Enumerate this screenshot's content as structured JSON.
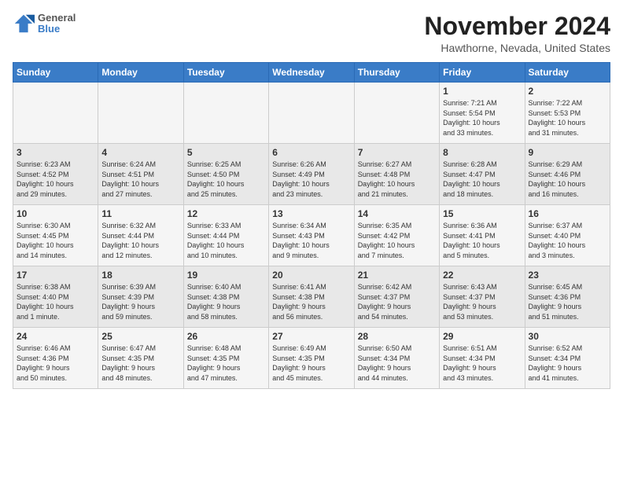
{
  "logo": {
    "line1": "General",
    "line2": "Blue"
  },
  "title": "November 2024",
  "location": "Hawthorne, Nevada, United States",
  "days_of_week": [
    "Sunday",
    "Monday",
    "Tuesday",
    "Wednesday",
    "Thursday",
    "Friday",
    "Saturday"
  ],
  "weeks": [
    [
      {
        "day": "",
        "info": ""
      },
      {
        "day": "",
        "info": ""
      },
      {
        "day": "",
        "info": ""
      },
      {
        "day": "",
        "info": ""
      },
      {
        "day": "",
        "info": ""
      },
      {
        "day": "1",
        "info": "Sunrise: 7:21 AM\nSunset: 5:54 PM\nDaylight: 10 hours\nand 33 minutes."
      },
      {
        "day": "2",
        "info": "Sunrise: 7:22 AM\nSunset: 5:53 PM\nDaylight: 10 hours\nand 31 minutes."
      }
    ],
    [
      {
        "day": "3",
        "info": "Sunrise: 6:23 AM\nSunset: 4:52 PM\nDaylight: 10 hours\nand 29 minutes."
      },
      {
        "day": "4",
        "info": "Sunrise: 6:24 AM\nSunset: 4:51 PM\nDaylight: 10 hours\nand 27 minutes."
      },
      {
        "day": "5",
        "info": "Sunrise: 6:25 AM\nSunset: 4:50 PM\nDaylight: 10 hours\nand 25 minutes."
      },
      {
        "day": "6",
        "info": "Sunrise: 6:26 AM\nSunset: 4:49 PM\nDaylight: 10 hours\nand 23 minutes."
      },
      {
        "day": "7",
        "info": "Sunrise: 6:27 AM\nSunset: 4:48 PM\nDaylight: 10 hours\nand 21 minutes."
      },
      {
        "day": "8",
        "info": "Sunrise: 6:28 AM\nSunset: 4:47 PM\nDaylight: 10 hours\nand 18 minutes."
      },
      {
        "day": "9",
        "info": "Sunrise: 6:29 AM\nSunset: 4:46 PM\nDaylight: 10 hours\nand 16 minutes."
      }
    ],
    [
      {
        "day": "10",
        "info": "Sunrise: 6:30 AM\nSunset: 4:45 PM\nDaylight: 10 hours\nand 14 minutes."
      },
      {
        "day": "11",
        "info": "Sunrise: 6:32 AM\nSunset: 4:44 PM\nDaylight: 10 hours\nand 12 minutes."
      },
      {
        "day": "12",
        "info": "Sunrise: 6:33 AM\nSunset: 4:44 PM\nDaylight: 10 hours\nand 10 minutes."
      },
      {
        "day": "13",
        "info": "Sunrise: 6:34 AM\nSunset: 4:43 PM\nDaylight: 10 hours\nand 9 minutes."
      },
      {
        "day": "14",
        "info": "Sunrise: 6:35 AM\nSunset: 4:42 PM\nDaylight: 10 hours\nand 7 minutes."
      },
      {
        "day": "15",
        "info": "Sunrise: 6:36 AM\nSunset: 4:41 PM\nDaylight: 10 hours\nand 5 minutes."
      },
      {
        "day": "16",
        "info": "Sunrise: 6:37 AM\nSunset: 4:40 PM\nDaylight: 10 hours\nand 3 minutes."
      }
    ],
    [
      {
        "day": "17",
        "info": "Sunrise: 6:38 AM\nSunset: 4:40 PM\nDaylight: 10 hours\nand 1 minute."
      },
      {
        "day": "18",
        "info": "Sunrise: 6:39 AM\nSunset: 4:39 PM\nDaylight: 9 hours\nand 59 minutes."
      },
      {
        "day": "19",
        "info": "Sunrise: 6:40 AM\nSunset: 4:38 PM\nDaylight: 9 hours\nand 58 minutes."
      },
      {
        "day": "20",
        "info": "Sunrise: 6:41 AM\nSunset: 4:38 PM\nDaylight: 9 hours\nand 56 minutes."
      },
      {
        "day": "21",
        "info": "Sunrise: 6:42 AM\nSunset: 4:37 PM\nDaylight: 9 hours\nand 54 minutes."
      },
      {
        "day": "22",
        "info": "Sunrise: 6:43 AM\nSunset: 4:37 PM\nDaylight: 9 hours\nand 53 minutes."
      },
      {
        "day": "23",
        "info": "Sunrise: 6:45 AM\nSunset: 4:36 PM\nDaylight: 9 hours\nand 51 minutes."
      }
    ],
    [
      {
        "day": "24",
        "info": "Sunrise: 6:46 AM\nSunset: 4:36 PM\nDaylight: 9 hours\nand 50 minutes."
      },
      {
        "day": "25",
        "info": "Sunrise: 6:47 AM\nSunset: 4:35 PM\nDaylight: 9 hours\nand 48 minutes."
      },
      {
        "day": "26",
        "info": "Sunrise: 6:48 AM\nSunset: 4:35 PM\nDaylight: 9 hours\nand 47 minutes."
      },
      {
        "day": "27",
        "info": "Sunrise: 6:49 AM\nSunset: 4:35 PM\nDaylight: 9 hours\nand 45 minutes."
      },
      {
        "day": "28",
        "info": "Sunrise: 6:50 AM\nSunset: 4:34 PM\nDaylight: 9 hours\nand 44 minutes."
      },
      {
        "day": "29",
        "info": "Sunrise: 6:51 AM\nSunset: 4:34 PM\nDaylight: 9 hours\nand 43 minutes."
      },
      {
        "day": "30",
        "info": "Sunrise: 6:52 AM\nSunset: 4:34 PM\nDaylight: 9 hours\nand 41 minutes."
      }
    ]
  ]
}
